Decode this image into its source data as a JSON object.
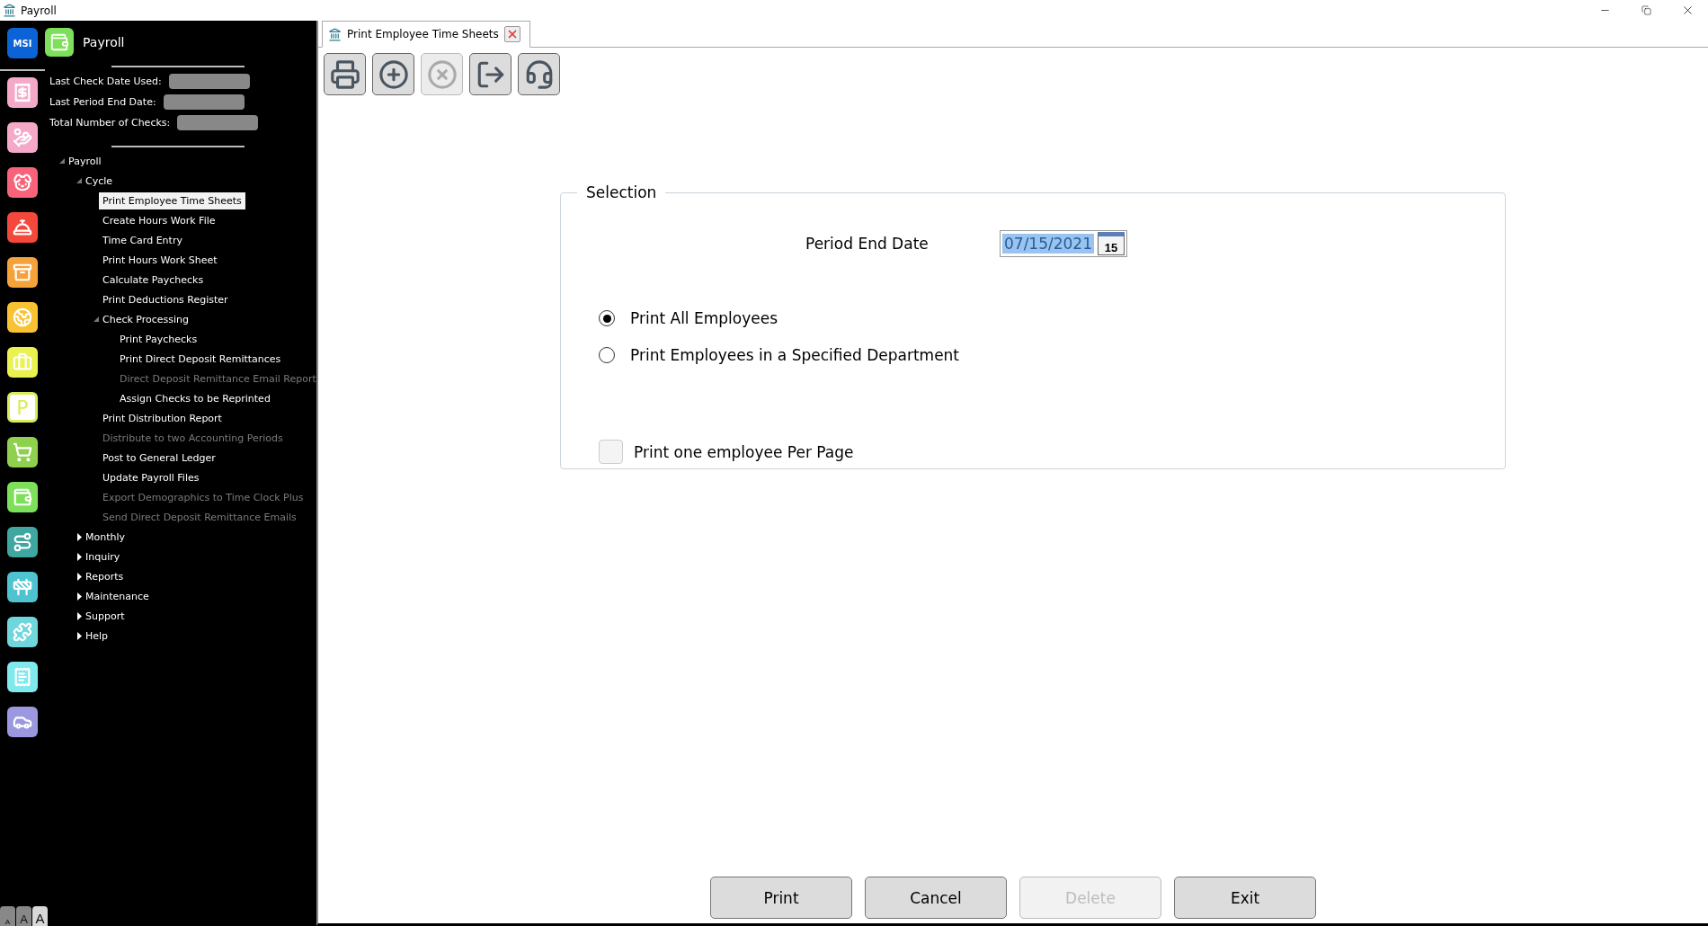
{
  "window": {
    "title": "Payroll"
  },
  "rail": {
    "logo": "MSI",
    "items": [
      {
        "kind": "receipt",
        "color": "#f4a9c9"
      },
      {
        "kind": "hand",
        "color": "#f4a9c9"
      },
      {
        "kind": "dog",
        "color": "#f7637a"
      },
      {
        "kind": "bell",
        "color": "#f5483d"
      },
      {
        "kind": "archive",
        "color": "#f6a23a"
      },
      {
        "kind": "globe",
        "color": "#f8c233"
      },
      {
        "kind": "briefcase",
        "color": "#e9f24e"
      },
      {
        "kind": "letter",
        "color": "#d9ec5a",
        "label": "P"
      },
      {
        "kind": "cart",
        "color": "#8fd14f"
      },
      {
        "kind": "wallet",
        "color": "#7ee05a"
      },
      {
        "kind": "route",
        "color": "#3fa6a0"
      },
      {
        "kind": "barrier",
        "color": "#4fc3cf"
      },
      {
        "kind": "puzzle",
        "color": "#6fd6dc"
      },
      {
        "kind": "list",
        "color": "#7fe9ee"
      },
      {
        "kind": "car",
        "color": "#9b98e0"
      }
    ]
  },
  "app_header": {
    "title": "Payroll"
  },
  "info": [
    {
      "label": "Last Check Date Used:"
    },
    {
      "label": "Last Period End Date:"
    },
    {
      "label": "Total Number of Checks:"
    }
  ],
  "tree": [
    {
      "label": "Payroll",
      "expanded": true,
      "selected": false,
      "disabled": false,
      "children": [
        {
          "label": "Cycle",
          "expanded": true,
          "selected": false,
          "disabled": false,
          "children": [
            {
              "label": "Print Employee Time Sheets",
              "selected": true,
              "disabled": false
            },
            {
              "label": "Create Hours Work File",
              "selected": false,
              "disabled": false
            },
            {
              "label": "Time Card Entry",
              "selected": false,
              "disabled": false
            },
            {
              "label": "Print Hours Work Sheet",
              "selected": false,
              "disabled": false
            },
            {
              "label": "Calculate Paychecks",
              "selected": false,
              "disabled": false
            },
            {
              "label": "Print Deductions Register",
              "selected": false,
              "disabled": false
            },
            {
              "label": "Check Processing",
              "expanded": true,
              "selected": false,
              "disabled": false,
              "children": [
                {
                  "label": "Print Paychecks",
                  "selected": false,
                  "disabled": false
                },
                {
                  "label": "Print Direct Deposit Remittances",
                  "selected": false,
                  "disabled": false
                },
                {
                  "label": "Direct Deposit Remittance Email Report",
                  "selected": false,
                  "disabled": true
                },
                {
                  "label": "Assign Checks to be Reprinted",
                  "selected": false,
                  "disabled": false
                }
              ]
            },
            {
              "label": "Print Distribution Report",
              "selected": false,
              "disabled": false
            },
            {
              "label": "Distribute to two Accounting Periods",
              "selected": false,
              "disabled": true
            },
            {
              "label": "Post to General Ledger",
              "selected": false,
              "disabled": false
            },
            {
              "label": "Update Payroll Files",
              "selected": false,
              "disabled": false
            },
            {
              "label": "Export Demographics to Time Clock Plus",
              "selected": false,
              "disabled": true
            },
            {
              "label": "Send Direct Deposit Remittance Emails",
              "selected": false,
              "disabled": true
            }
          ]
        },
        {
          "label": "Monthly",
          "expanded": false,
          "selected": false,
          "disabled": false
        },
        {
          "label": "Inquiry",
          "expanded": false,
          "selected": false,
          "disabled": false
        },
        {
          "label": "Reports",
          "expanded": false,
          "selected": false,
          "disabled": false
        },
        {
          "label": "Maintenance",
          "expanded": false,
          "selected": false,
          "disabled": false
        },
        {
          "label": "Support",
          "expanded": false,
          "selected": false,
          "disabled": false
        },
        {
          "label": "Help",
          "expanded": false,
          "selected": false,
          "disabled": false
        }
      ]
    }
  ],
  "font_sizes": [
    {
      "label": "A",
      "selected": false
    },
    {
      "label": "A",
      "selected": false
    },
    {
      "label": "A",
      "selected": true
    }
  ],
  "tab": {
    "title": "Print Employee Time Sheets"
  },
  "toolbar": [
    {
      "kind": "print",
      "disabled": false
    },
    {
      "kind": "add",
      "disabled": false
    },
    {
      "kind": "cancel",
      "disabled": true
    },
    {
      "kind": "exit",
      "disabled": false
    },
    {
      "kind": "support",
      "disabled": false
    }
  ],
  "selection": {
    "title": "Selection",
    "period_label": "Period End Date",
    "period_value": "07/15/2021",
    "calendar_day": "15",
    "options": [
      {
        "label": "Print All Employees",
        "selected": true
      },
      {
        "label": "Print Employees in a Specified Department",
        "selected": false
      }
    ],
    "one_per_page": {
      "label": "Print one employee Per Page",
      "checked": false
    }
  },
  "buttons": [
    {
      "label": "Print",
      "disabled": false
    },
    {
      "label": "Cancel",
      "disabled": false
    },
    {
      "label": "Delete",
      "disabled": true
    },
    {
      "label": "Exit",
      "disabled": false
    }
  ]
}
